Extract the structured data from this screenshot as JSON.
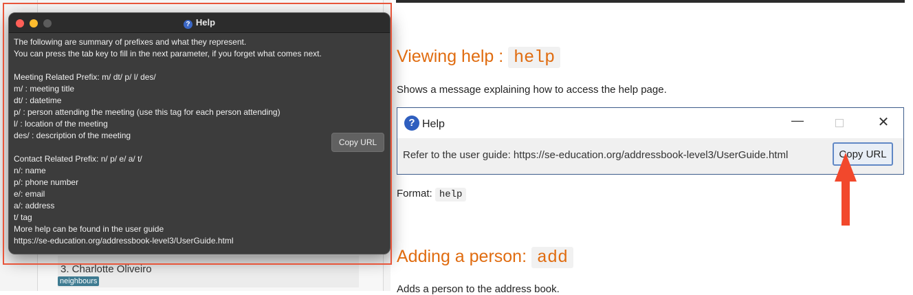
{
  "background_app": {
    "person_label": "3.  Charlotte Oliveiro",
    "tag": "neighbours"
  },
  "help_window": {
    "title": "Help",
    "lines": [
      "The following are summary of prefixes and what they represent.",
      "You can press the tab key to fill in the next parameter, if you forget what comes next.",
      "",
      "Meeting Related Prefix: m/ dt/ p/ l/ des/",
      "m/ : meeting title",
      "dt/ : datetime",
      "p/ : person attending the meeting (use this tag for each person attending)",
      "l/ : location of the meeting",
      "des/ : description of the meeting",
      "",
      "Contact Related Prefix: n/ p/ e/ a/ t/",
      "n/: name",
      "p/: phone number",
      "e/: email",
      "a/: address",
      "t/ tag",
      "More help can be found in the user guide",
      "https://se-education.org/addressbook-level3/UserGuide.html"
    ],
    "copy_button": "Copy URL"
  },
  "doc": {
    "viewing_help_heading": "Viewing help : ",
    "viewing_help_code": "help",
    "viewing_help_desc": "Shows a message explaining how to access the help page.",
    "screenshot": {
      "title": "Help",
      "text": "Refer to the user guide: https://se-education.org/addressbook-level3/UserGuide.html",
      "copy_button": "Copy URL"
    },
    "format_label": "Format: ",
    "format_code": "help",
    "adding_heading": "Adding a person: ",
    "adding_code": "add",
    "adding_desc": "Adds a person to the address book."
  },
  "colors": {
    "accent_orange": "#e06c10",
    "annotation_red": "#e8553a",
    "arrow_red": "#f2482c"
  },
  "icons": {
    "help_icon": "question-mark-circle",
    "close_icon": "x",
    "minimize_icon": "dash",
    "maximize_icon": "square"
  }
}
